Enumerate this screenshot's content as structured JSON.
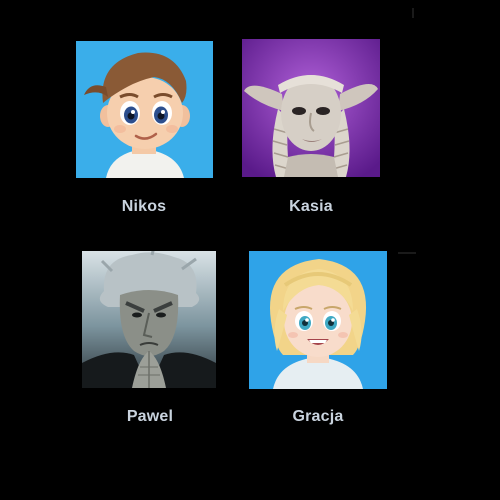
{
  "profiles": [
    {
      "name": "Nikos",
      "avatar_icon": "cartoon-boy-avatar-icon",
      "bg_color": "#3aaeea"
    },
    {
      "name": "Kasia",
      "avatar_icon": "gelfling-avatar-icon",
      "bg_color": "#7a2aa8"
    },
    {
      "name": "Pawel",
      "avatar_icon": "count-olaf-avatar-icon",
      "bg_color": "#6f8791"
    },
    {
      "name": "Gracja",
      "avatar_icon": "cartoon-girl-avatar-icon",
      "bg_color": "#2fa3e8"
    }
  ]
}
